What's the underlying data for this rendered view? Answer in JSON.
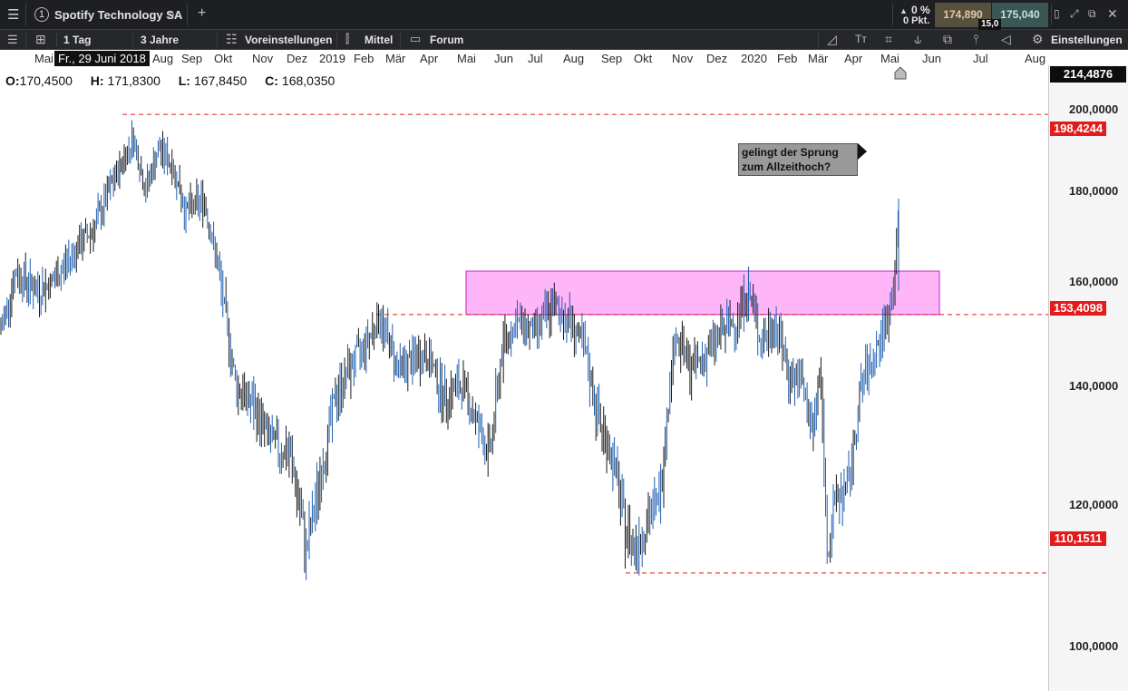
{
  "window": {
    "tab_number": "1",
    "tab_title": "Spotify Technology SA",
    "change_pct": "0 %",
    "change_pts": "0 Pkt.",
    "bid": "174,890",
    "ask": "175,040",
    "spread": "15,0"
  },
  "toolbar": {
    "interval": "1 Tag",
    "range": "3 Jahre",
    "presets": "Voreinstellungen",
    "indicator": "Mittel",
    "forum": "Forum",
    "settings": "Einstellungen"
  },
  "time_axis": {
    "tooltip": "Fr., 29 Juni 2018",
    "labels": [
      "Mai",
      "Aug",
      "Sep",
      "Okt",
      "Nov",
      "Dez",
      "2019",
      "Feb",
      "Mär",
      "Apr",
      "Mai",
      "Jun",
      "Jul",
      "Aug",
      "Sep",
      "Okt",
      "Nov",
      "Dez",
      "2020",
      "Feb",
      "Mär",
      "Apr",
      "Mai",
      "Jun",
      "Jul",
      "Aug"
    ]
  },
  "ohlc": {
    "open_label": "O:",
    "open": "170,4500",
    "high_label": "H:",
    "high": "171,8300",
    "low_label": "L:",
    "low": "167,8450",
    "close_label": "C:",
    "close": "168,0350"
  },
  "price_axis": {
    "current": "214,4876",
    "ticks": [
      "200,0000",
      "180,0000",
      "160,0000",
      "140,0000",
      "120,0000",
      "100,0000"
    ],
    "levels": [
      "198,4244",
      "153,4098",
      "110,1511"
    ]
  },
  "annotation": {
    "line1": "gelingt der Sprung",
    "line2": "zum Allzeithoch?"
  },
  "chart_data": {
    "type": "ohlc",
    "instrument": "Spotify Technology SA",
    "interval": "1 Tag",
    "x": [
      "2018-05",
      "2018-06",
      "2018-07",
      "2018-08",
      "2018-09",
      "2018-10",
      "2018-11",
      "2018-12",
      "2019-01",
      "2019-02",
      "2019-03",
      "2019-04",
      "2019-05",
      "2019-06",
      "2019-07",
      "2019-08",
      "2019-09",
      "2019-10",
      "2019-11",
      "2019-12",
      "2020-01",
      "2020-02",
      "2020-03",
      "2020-04",
      "2020-05"
    ],
    "close": [
      160,
      175,
      190,
      178,
      165,
      150,
      125,
      115,
      135,
      148,
      145,
      140,
      132,
      145,
      152,
      150,
      125,
      118,
      148,
      142,
      152,
      150,
      112,
      140,
      178
    ],
    "ylim": [
      93,
      214
    ],
    "horizontal_levels": [
      198.4244,
      153.4098,
      110.1511
    ],
    "zone": {
      "low": 153.4098,
      "high": 162,
      "from": "2019-05",
      "to": "2020-05"
    },
    "colors": {
      "bars": "#1f5fb0",
      "levels": "#e31b1b",
      "zone_fill": "#ffb6f8",
      "zone_border": "#c020c0"
    }
  }
}
